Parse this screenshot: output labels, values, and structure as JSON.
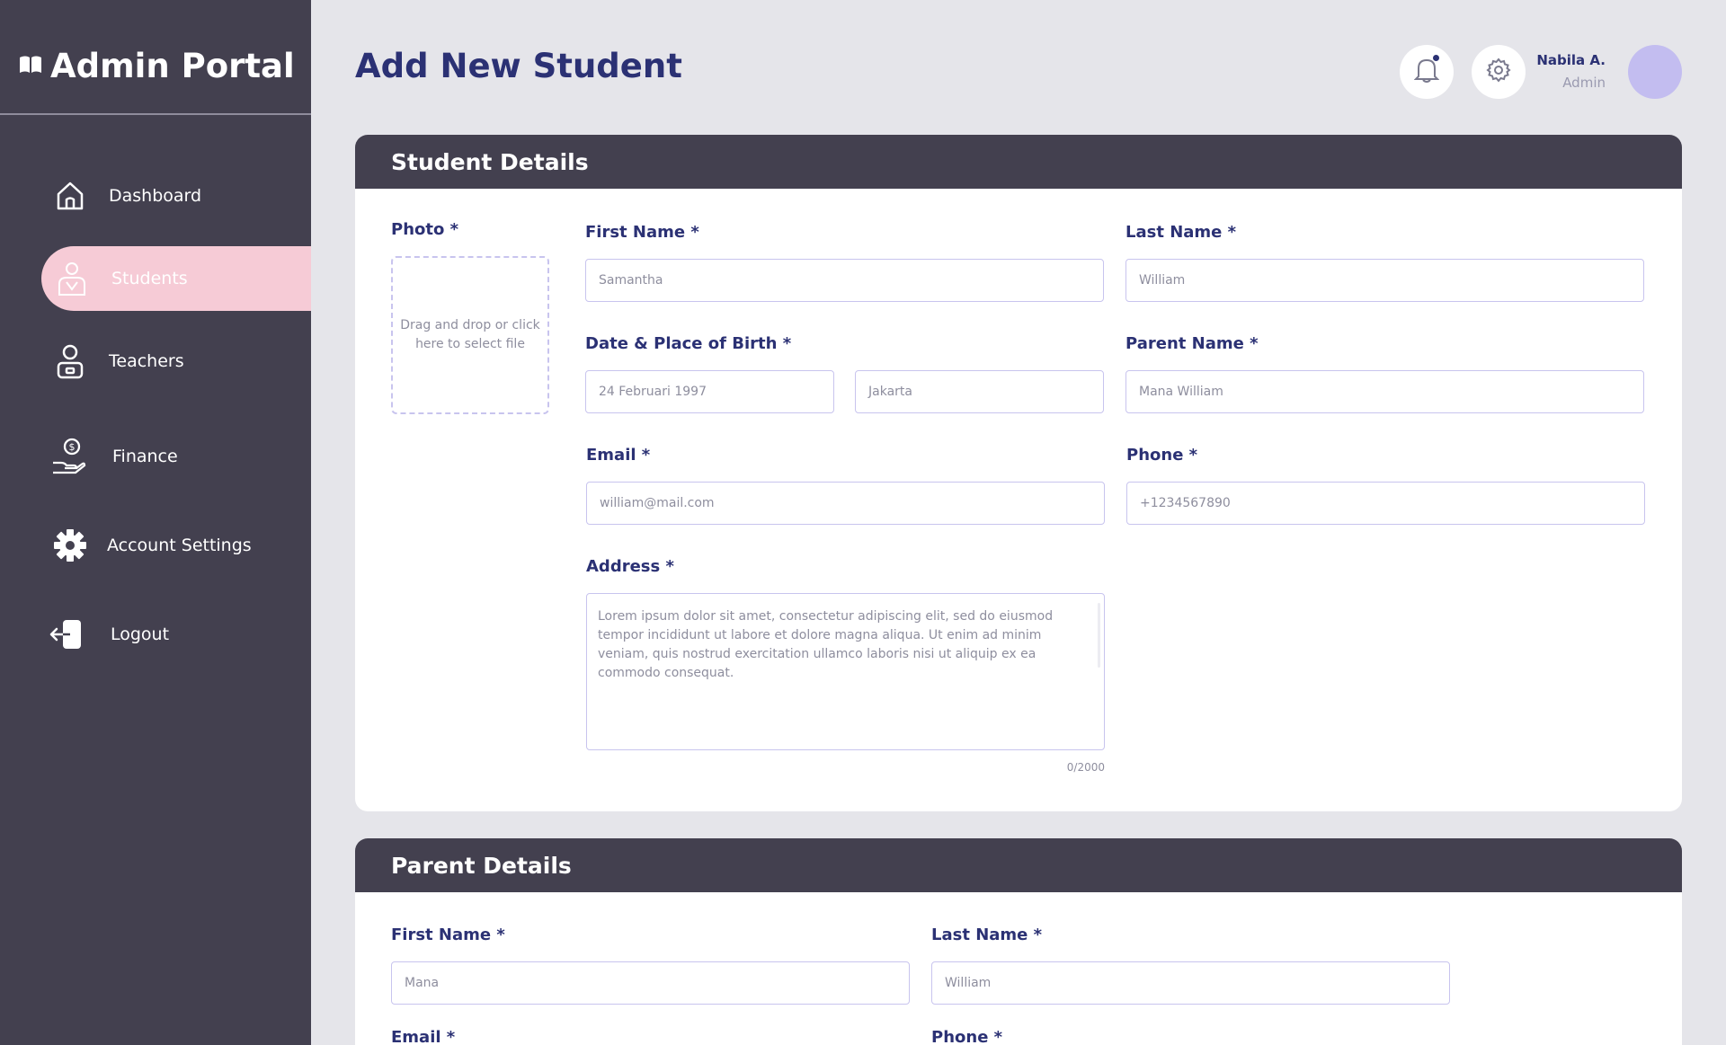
{
  "app": {
    "title": "Admin Portal",
    "logo_icon": "book-icon"
  },
  "sidebar": {
    "items": [
      {
        "label": "Dashboard",
        "icon": "home-icon",
        "active": false
      },
      {
        "label": "Students",
        "icon": "student-icon",
        "active": true
      },
      {
        "label": "Teachers",
        "icon": "teacher-icon",
        "active": false
      },
      {
        "label": "Finance",
        "icon": "finance-icon",
        "active": false
      },
      {
        "label": "Account Settings",
        "icon": "gear-icon",
        "active": false
      },
      {
        "label": "Logout",
        "icon": "logout-icon",
        "active": false
      }
    ]
  },
  "header": {
    "title": "Add New Student",
    "user": {
      "name": "Nabila A.",
      "role": "Admin"
    }
  },
  "student": {
    "section_title": "Student Details",
    "photo": {
      "label": "Photo *",
      "dropzone_text": "Drag and drop or click here to select file"
    },
    "first_name": {
      "label": "First Name *",
      "placeholder": "Samantha"
    },
    "last_name": {
      "label": "Last Name *",
      "placeholder": "William"
    },
    "birth": {
      "label": "Date & Place of Birth *",
      "date_placeholder": "24 Februari 1997",
      "place_placeholder": "Jakarta"
    },
    "parent_name": {
      "label": "Parent Name *",
      "placeholder": "Mana William"
    },
    "email": {
      "label": "Email *",
      "placeholder": "william@mail.com"
    },
    "phone": {
      "label": "Phone *",
      "placeholder": "+1234567890"
    },
    "address": {
      "label": "Address *",
      "placeholder": "Lorem ipsum dolor sit amet, consectetur adipiscing elit, sed do eiusmod tempor incididunt ut labore et dolore magna aliqua. Ut enim ad minim veniam, quis nostrud exercitation ullamco laboris nisi ut aliquip ex ea commodo consequat.",
      "counter": "0/2000"
    }
  },
  "parent": {
    "section_title": "Parent Details",
    "first_name": {
      "label": "First Name *",
      "placeholder": "Mana"
    },
    "last_name": {
      "label": "Last Name *",
      "placeholder": "William"
    },
    "email": {
      "label": "Email *"
    },
    "phone": {
      "label": "Phone *"
    }
  },
  "colors": {
    "sidebar": "#43404f",
    "accent_navy": "#2b3174",
    "active_pink": "#f6cbd6",
    "avatar": "#c3bdf0",
    "background": "#e5e5ea"
  }
}
